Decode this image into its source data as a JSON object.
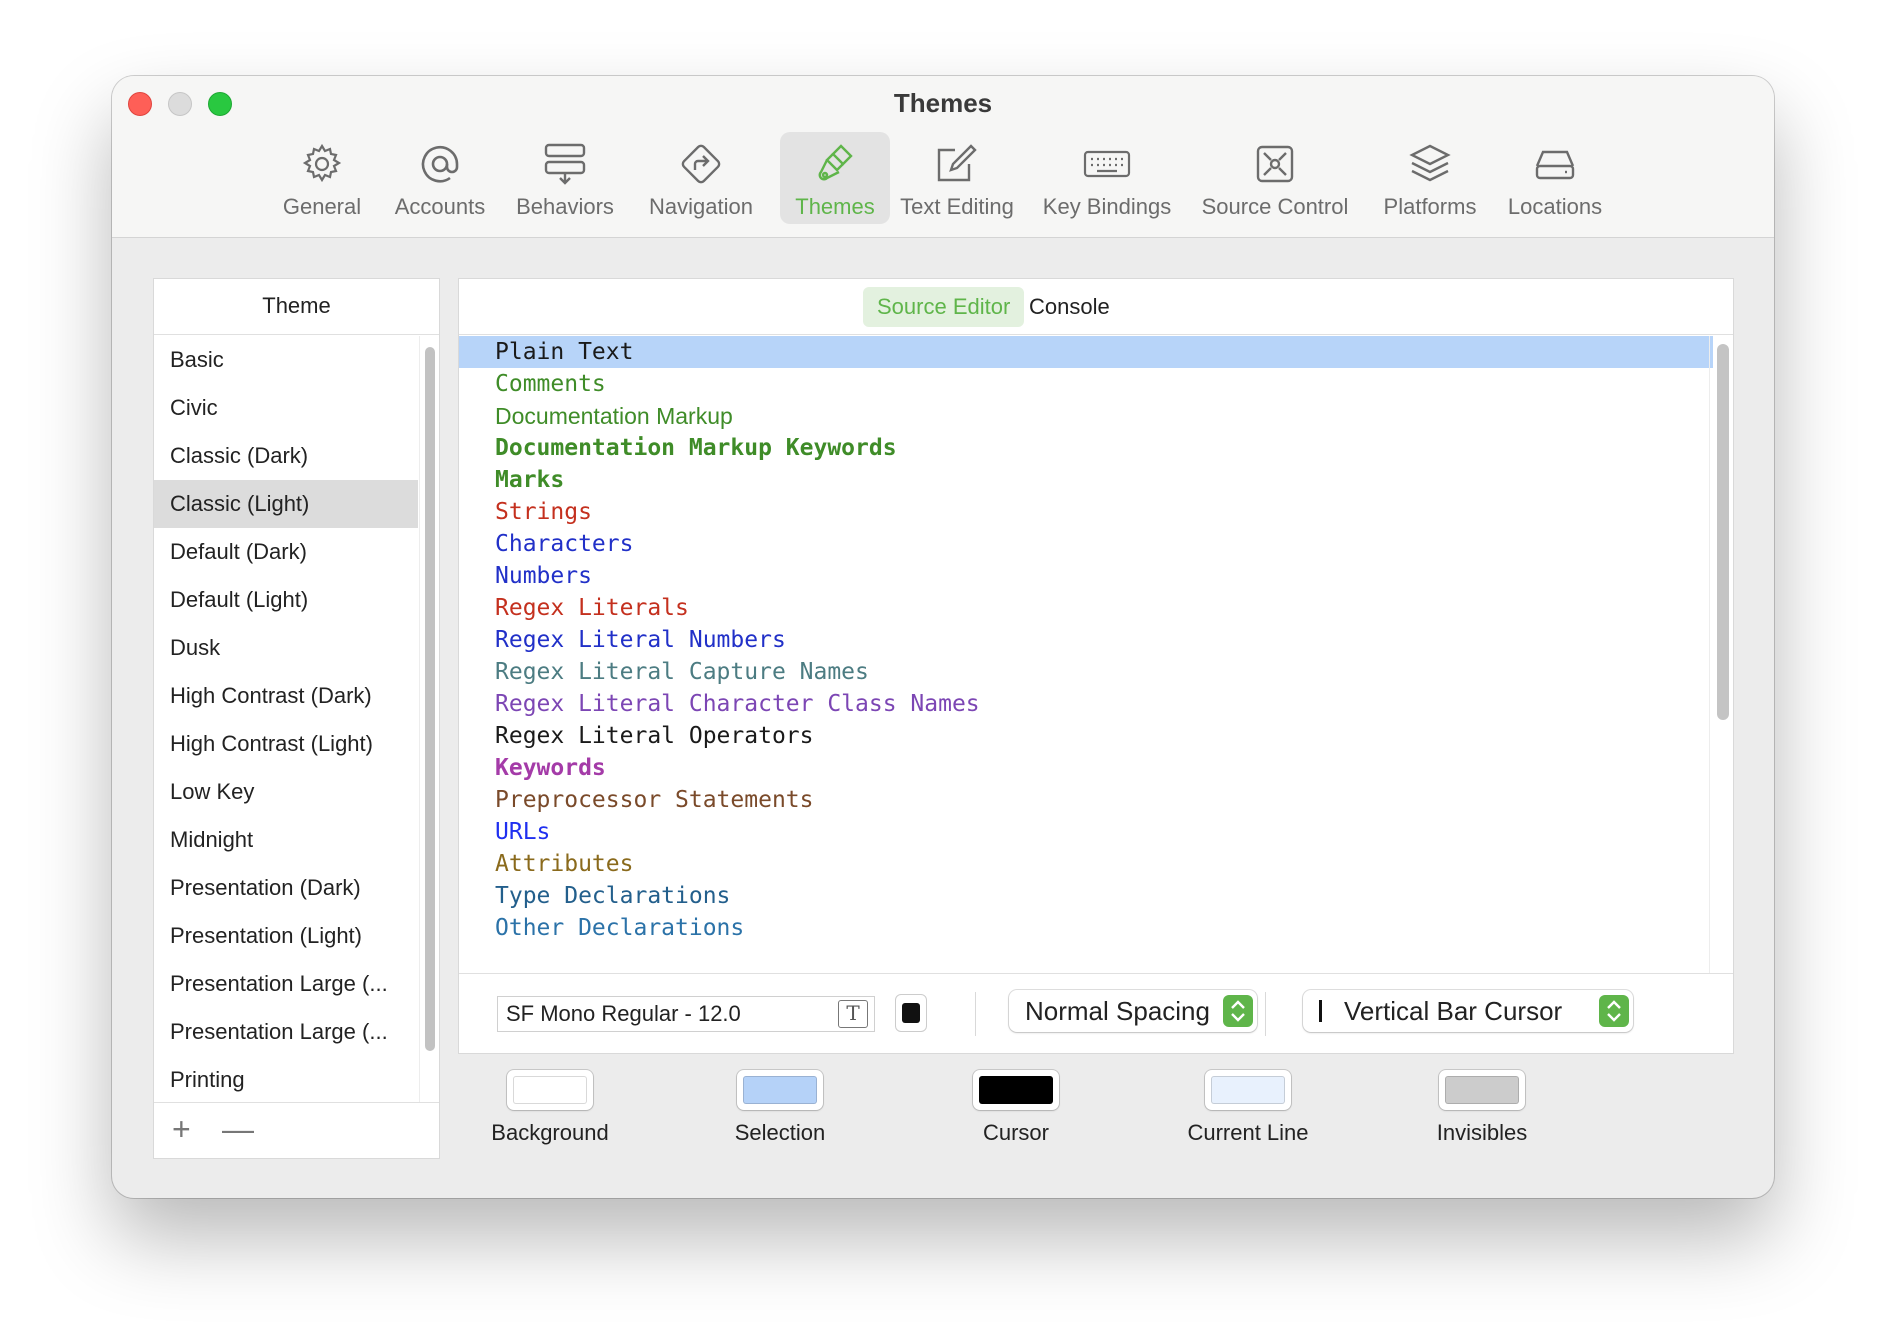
{
  "window": {
    "title": "Themes"
  },
  "toolbar": {
    "items": [
      {
        "label": "General",
        "icon": "gear-icon"
      },
      {
        "label": "Accounts",
        "icon": "at-icon"
      },
      {
        "label": "Behaviors",
        "icon": "behaviors-icon"
      },
      {
        "label": "Navigation",
        "icon": "navigation-icon"
      },
      {
        "label": "Themes",
        "icon": "paintbrush-icon",
        "active": true
      },
      {
        "label": "Text Editing",
        "icon": "pencil-square-icon"
      },
      {
        "label": "Key Bindings",
        "icon": "keyboard-icon"
      },
      {
        "label": "Source Control",
        "icon": "source-control-icon"
      },
      {
        "label": "Platforms",
        "icon": "layers-icon"
      },
      {
        "label": "Locations",
        "icon": "drive-icon"
      }
    ]
  },
  "theme_panel": {
    "header": "Theme",
    "items": [
      "Basic",
      "Civic",
      "Classic (Dark)",
      "Classic (Light)",
      "Default (Dark)",
      "Default (Light)",
      "Dusk",
      "High Contrast (Dark)",
      "High Contrast (Light)",
      "Low Key",
      "Midnight",
      "Presentation (Dark)",
      "Presentation (Light)",
      "Presentation Large (...",
      "Presentation Large (...",
      "Printing"
    ],
    "selected": "Classic (Light)",
    "add_label": "+",
    "remove_label": "—"
  },
  "editor": {
    "tabs": [
      {
        "label": "Source Editor",
        "active": true
      },
      {
        "label": "Console",
        "active": false
      }
    ],
    "syntax_items": [
      {
        "label": "Plain Text",
        "color": "#1a1a1a",
        "bold": false,
        "mono": true,
        "selected": true
      },
      {
        "label": "Comments",
        "color": "#3f8c28",
        "bold": false,
        "mono": true
      },
      {
        "label": "Documentation Markup",
        "color": "#3f8c28",
        "bold": false,
        "mono": false
      },
      {
        "label": "Documentation Markup Keywords",
        "color": "#3f8c28",
        "bold": true,
        "mono": true
      },
      {
        "label": "Marks",
        "color": "#3f8c28",
        "bold": true,
        "mono": true
      },
      {
        "label": "Strings",
        "color": "#c4301e",
        "bold": false,
        "mono": true
      },
      {
        "label": "Characters",
        "color": "#2130c8",
        "bold": false,
        "mono": true
      },
      {
        "label": "Numbers",
        "color": "#2130c8",
        "bold": false,
        "mono": true
      },
      {
        "label": "Regex Literals",
        "color": "#c4301e",
        "bold": false,
        "mono": true
      },
      {
        "label": "Regex Literal Numbers",
        "color": "#2130c8",
        "bold": false,
        "mono": true
      },
      {
        "label": "Regex Literal Capture Names",
        "color": "#4c7c82",
        "bold": false,
        "mono": true
      },
      {
        "label": "Regex Literal Character Class Names",
        "color": "#7c46b4",
        "bold": false,
        "mono": true
      },
      {
        "label": "Regex Literal Operators",
        "color": "#1a1a1a",
        "bold": false,
        "mono": true
      },
      {
        "label": "Keywords",
        "color": "#a43ba8",
        "bold": true,
        "mono": true
      },
      {
        "label": "Preprocessor Statements",
        "color": "#7a4a2a",
        "bold": false,
        "mono": true
      },
      {
        "label": "URLs",
        "color": "#1f2ff0",
        "bold": false,
        "mono": true
      },
      {
        "label": "Attributes",
        "color": "#8a6a1c",
        "bold": false,
        "mono": true
      },
      {
        "label": "Type Declarations",
        "color": "#235f8c",
        "bold": false,
        "mono": true
      },
      {
        "label": "Other Declarations",
        "color": "#2b72a8",
        "bold": false,
        "mono": true
      }
    ],
    "font_field": "SF Mono Regular - 12.0",
    "spacing_popup": "Normal Spacing",
    "cursor_popup": "Vertical Bar Cursor"
  },
  "swatches": [
    {
      "label": "Background",
      "color": "#ffffff"
    },
    {
      "label": "Selection",
      "color": "#b5d2f8"
    },
    {
      "label": "Cursor",
      "color": "#000000"
    },
    {
      "label": "Current Line",
      "color": "#e8f1fd"
    },
    {
      "label": "Invisibles",
      "color": "#cccccc"
    }
  ],
  "accent_color": "#5fb54a"
}
